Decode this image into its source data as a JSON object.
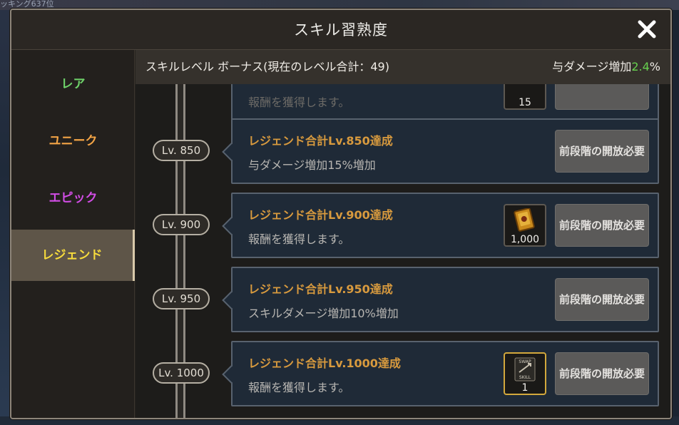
{
  "background": {
    "top_text": "ッキング637位"
  },
  "window": {
    "title": "スキル習熟度",
    "close_icon": "close-icon"
  },
  "tabs": [
    {
      "label": "レア",
      "color": "#6fd36a"
    },
    {
      "label": "ユニーク",
      "color": "#f3a446"
    },
    {
      "label": "エピック",
      "color": "#d24de6"
    },
    {
      "label": "レジェンド",
      "color": "#f7dc3c",
      "selected": true
    }
  ],
  "bonus": {
    "label": "スキルレベル ボーナス(現在のレベル合計：49)",
    "damage_label": "与ダメージ増加",
    "damage_value": "2.4",
    "damage_unit": "%"
  },
  "partial_item": {
    "desc": "報酬を獲得します。",
    "reward_count": "15"
  },
  "items": [
    {
      "level": "Lv. 850",
      "title": "レジェンド合計Lv.850達成",
      "desc": "与ダメージ増加15%増加",
      "button": "前段階の開放必要"
    },
    {
      "level": "Lv. 900",
      "title": "レジェンド合計Lv.900達成",
      "desc": "報酬を獲得します。",
      "button": "前段階の開放必要",
      "reward": {
        "icon": "skill-book-icon",
        "count": "1,000"
      }
    },
    {
      "level": "Lv. 950",
      "title": "レジェンド合計Lv.950達成",
      "desc": "スキルダメージ増加10%増加",
      "button": "前段階の開放必要"
    },
    {
      "level": "Lv. 1000",
      "title": "レジェンド合計Lv.1000達成",
      "desc": "報酬を獲得します。",
      "button": "前段階の開放必要",
      "reward": {
        "icon": "swap-skill-ticket-icon",
        "count": "1",
        "label": "SWAP SKILL"
      }
    }
  ]
}
